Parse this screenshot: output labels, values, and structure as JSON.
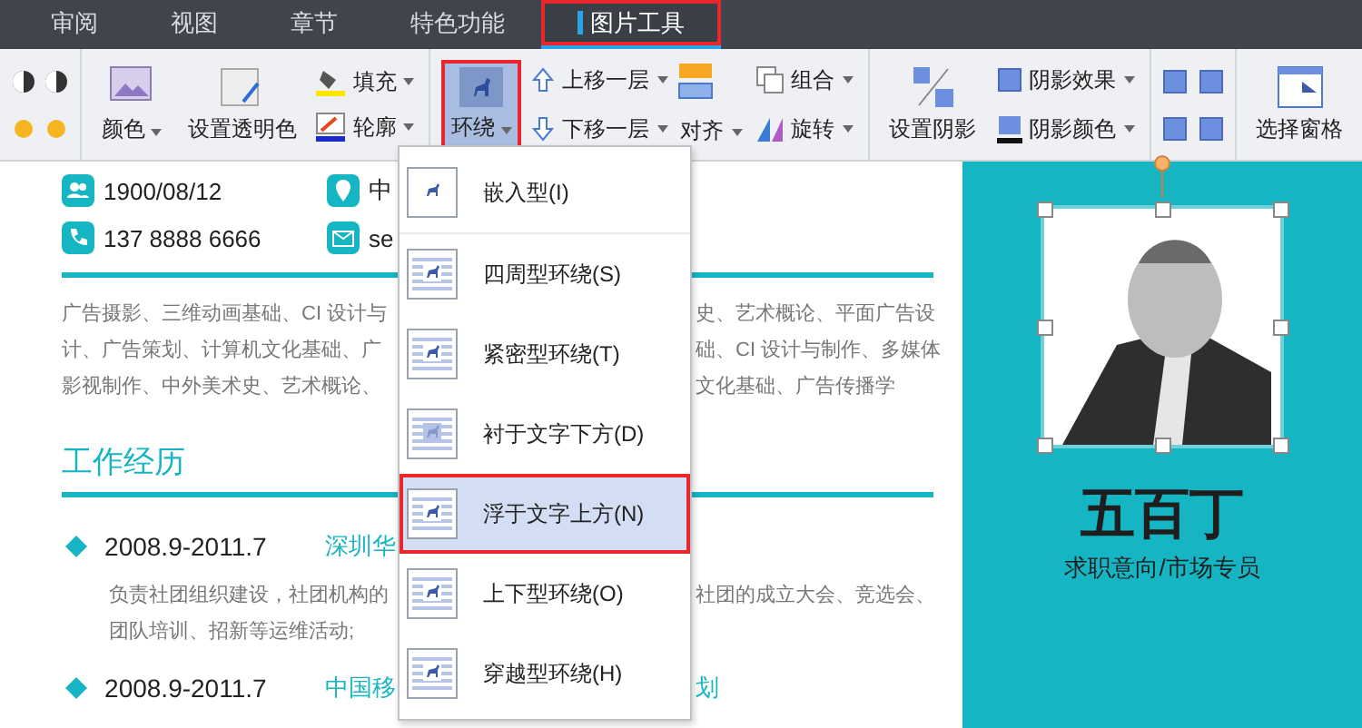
{
  "ribbon_tabs": [
    {
      "label": "审阅",
      "selected": false,
      "highlighted": false
    },
    {
      "label": "视图",
      "selected": false,
      "highlighted": false
    },
    {
      "label": "章节",
      "selected": false,
      "highlighted": false
    },
    {
      "label": "特色功能",
      "selected": false,
      "highlighted": false
    },
    {
      "label": "图片工具",
      "selected": true,
      "highlighted": true
    }
  ],
  "toolbar": {
    "recolor": "颜色",
    "transparent": "设置透明色",
    "fill": "填充",
    "outline": "轮廓",
    "wrap": {
      "label": "环绕",
      "pressed": true,
      "highlighted": true
    },
    "bring_forward": "上移一层",
    "send_backward": "下移一层",
    "align": "对齐",
    "group": "组合",
    "rotate": "旋转",
    "shadow": "设置阴影",
    "shadow_effect": "阴影效果",
    "shadow_color": "阴影颜色",
    "selection_pane": "选择窗格"
  },
  "wrap_menu": [
    {
      "label": "嵌入型(I)",
      "selected": false,
      "highlighted": false
    },
    {
      "label": "四周型环绕(S)",
      "selected": false,
      "highlighted": false
    },
    {
      "label": "紧密型环绕(T)",
      "selected": false,
      "highlighted": false
    },
    {
      "label": "衬于文字下方(D)",
      "selected": false,
      "highlighted": false
    },
    {
      "label": "浮于文字上方(N)",
      "selected": true,
      "highlighted": true
    },
    {
      "label": "上下型环绕(O)",
      "selected": false,
      "highlighted": false
    },
    {
      "label": "穿越型环绕(H)",
      "selected": false,
      "highlighted": false
    }
  ],
  "resume": {
    "contacts": [
      [
        "1900/08/12",
        "中"
      ],
      [
        "137 8888 6666",
        "se"
      ]
    ],
    "courses": [
      [
        "广告摄影、三维动画基础、CI 设计与",
        "史、艺术概论、平面广告设"
      ],
      [
        "计、广告策划、计算机文化基础、广",
        "础、CI 设计与制作、多媒体"
      ],
      [
        "影视制作、中外美术史、艺术概论、",
        "文化基础、广告传播学"
      ]
    ],
    "work_heading": "工作经历",
    "jobs": [
      {
        "date": "2008.9-2011.7",
        "company": "深圳华",
        "details": [
          [
            "负责社团组织建设，社团机构的",
            "社团的成立大会、竞选会、"
          ],
          [
            "团队培训、招新等运维活动;"
          ]
        ]
      },
      {
        "date": "2008.9-2011.7",
        "company": "中国移",
        "company_right": "划"
      }
    ],
    "name": "五百丁",
    "objective": "求职意向/市场专员"
  }
}
